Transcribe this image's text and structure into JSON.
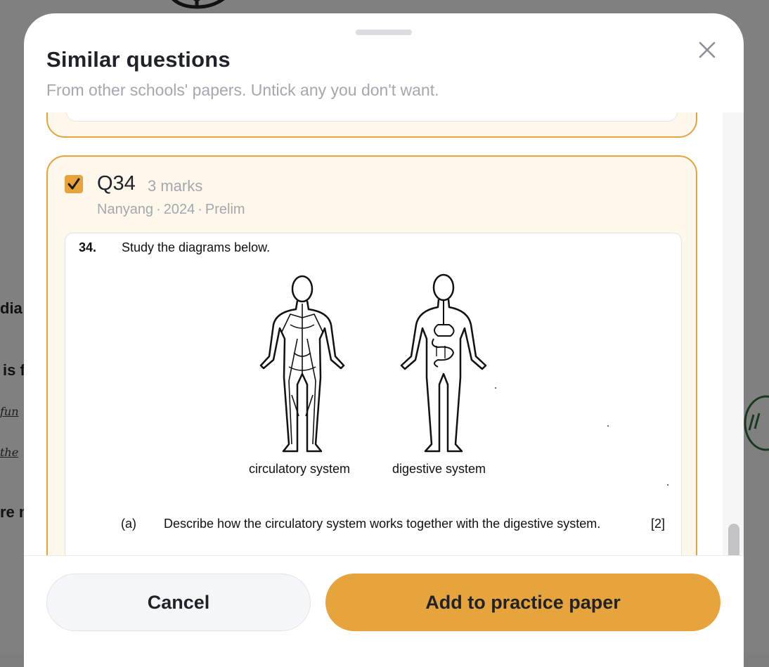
{
  "background": {
    "fragments": [
      "dia",
      "is f",
      "re m"
    ],
    "handwriting": [
      "fun",
      "the"
    ]
  },
  "modal": {
    "title": "Similar questions",
    "subtitle": "From other schools' papers. Untick any you don't want.",
    "close_icon": "close-icon"
  },
  "question": {
    "checked": true,
    "number": "Q34",
    "marks": "3 marks",
    "school": "Nanyang",
    "year": "2024",
    "paper": "Prelim",
    "separator": "·",
    "image": {
      "num": "34.",
      "stem": "Study the diagrams below.",
      "caption_left": "circulatory system",
      "caption_right": "digestive system",
      "part_label": "(a)",
      "part_text": "Describe how the circulatory system works together with the digestive system.",
      "part_marks": "[2]"
    }
  },
  "footer": {
    "cancel_label": "Cancel",
    "add_label": "Add to practice paper"
  },
  "colors": {
    "accent": "#e8a43c",
    "card_bg": "#fef7ec",
    "card_border": "#e6a43d"
  }
}
